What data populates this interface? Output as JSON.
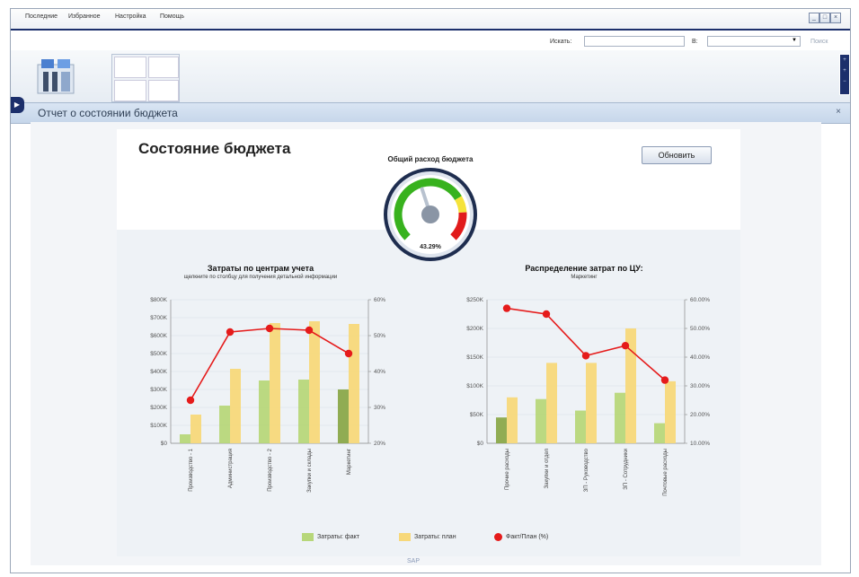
{
  "menu": {
    "items": [
      "Последние",
      "Избранное",
      "Настройка",
      "Помощь"
    ]
  },
  "window_controls": [
    "_",
    "□",
    "×"
  ],
  "search": {
    "label": "Искать:",
    "in_label": "В:",
    "value": "",
    "scope_value": "",
    "button": "Поиск"
  },
  "right_strip": [
    "+",
    "+",
    "−"
  ],
  "panel": {
    "title": "Отчет о состоянии бюджета",
    "close": "×",
    "left_toggle": "▶"
  },
  "dashboard": {
    "title": "Состояние бюджета",
    "refresh_label": "Обновить",
    "gauge": {
      "title": "Общий расход бюджета",
      "value_label": "43.29%",
      "value": 43.29,
      "max": 100
    }
  },
  "legend": {
    "fact": "Затраты: факт",
    "plan": "Затраты: план",
    "ratio": "Факт/План (%)"
  },
  "colors": {
    "fact": "#b7d77a",
    "plan": "#f7d87a",
    "ratio": "#e51b1b",
    "brand": "#1c2f6b"
  },
  "footer": {
    "logo": "SAP"
  },
  "chart_data": [
    {
      "type": "bar",
      "title": "Затраты по центрам учета",
      "subtitle": "щелкните по столбцу для получения детальной информации",
      "categories": [
        "Производство - 1",
        "Администрация",
        "Производство - 2",
        "Закупки и склады",
        "Маркетинг"
      ],
      "series": [
        {
          "name": "Затраты: факт",
          "values": [
            50,
            210,
            350,
            355,
            300
          ],
          "axis": "left"
        },
        {
          "name": "Затраты: план",
          "values": [
            160,
            415,
            670,
            680,
            665
          ],
          "axis": "left"
        },
        {
          "name": "Факт/План (%)",
          "values": [
            32,
            51,
            52,
            51.5,
            45
          ],
          "axis": "right",
          "type": "line"
        }
      ],
      "left_ticks": [
        "$0",
        "$100K",
        "$200K",
        "$300K",
        "$400K",
        "$500K",
        "$600K",
        "$700K",
        "$800K"
      ],
      "right_ticks": [
        "20%",
        "30%",
        "40%",
        "50%",
        "60%"
      ],
      "ylim_left": [
        0,
        800
      ],
      "ylim_right": [
        20,
        60
      ]
    },
    {
      "type": "bar",
      "title": "Распределение затрат по ЦУ:",
      "subtitle": "Маркетинг",
      "categories": [
        "Прочие расходы",
        "Закупки и отдел",
        "ЗП - Руководство",
        "ЗП - Сотрудники",
        "Почтовые расходы"
      ],
      "series": [
        {
          "name": "Затраты: факт",
          "values": [
            45,
            77,
            57,
            88,
            35
          ],
          "axis": "left"
        },
        {
          "name": "Затраты: план",
          "values": [
            80,
            140,
            140,
            200,
            108
          ],
          "axis": "left"
        },
        {
          "name": "Факт/План (%)",
          "values": [
            57,
            55,
            40.5,
            44,
            32
          ],
          "axis": "right",
          "type": "line"
        }
      ],
      "left_ticks": [
        "$0",
        "$50K",
        "$100K",
        "$150K",
        "$200K",
        "$250K"
      ],
      "right_ticks": [
        "10.00%",
        "20.00%",
        "30.00%",
        "40.00%",
        "50.00%",
        "60.00%"
      ],
      "ylim_left": [
        0,
        250
      ],
      "ylim_right": [
        10,
        60
      ]
    }
  ]
}
